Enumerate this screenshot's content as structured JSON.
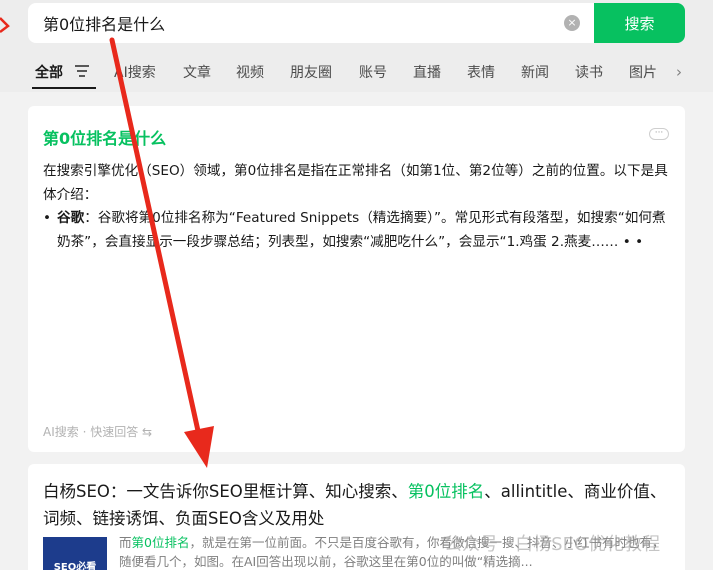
{
  "search": {
    "query": "第0位排名是什么",
    "clear_icon": "×",
    "button_label": "搜索"
  },
  "tabs": [
    {
      "label": "全部",
      "active": true
    },
    {
      "label": "AI搜索"
    },
    {
      "label": "文章"
    },
    {
      "label": "视频"
    },
    {
      "label": "朋友圈"
    },
    {
      "label": "账号"
    },
    {
      "label": "直播"
    },
    {
      "label": "表情"
    },
    {
      "label": "新闻"
    },
    {
      "label": "读书"
    },
    {
      "label": "图片"
    }
  ],
  "tabs_more_icon": "›",
  "ai_card": {
    "title": "第0位排名是什么",
    "more_icon": "···",
    "paragraph": "在搜索引擎优化（SEO）领域，第0位排名是指在正常排名（如第1位、第2位等）之前的位置。以下是具体介绍：",
    "bullet_label": "谷歌",
    "bullet_text": "：谷歌将第0位排名称为“Featured Snippets（精选摘要）”。常见形式有段落型，如搜索“如何煮奶茶”，会直接显示一段步骤总结；列表型，如搜索“减肥吃什么”，会显示“1.鸡蛋 2.燕麦……",
    "bullet_dots": "• •",
    "footer": "AI搜索 · 快速回答 ⇆"
  },
  "result": {
    "title_prefix": "白杨SEO：一文告诉你SEO里框计算、知心搜索、",
    "title_highlight": "第0位排名",
    "title_suffix": "、allintitle、商业价值、词频、链接诱饵、负面SEO含义及用处",
    "thumb_text": "SEO必看",
    "snippet_prefix": "而",
    "snippet_highlight": "第0位排名",
    "snippet_rest": "，就是在第一位前面。不只是百度谷歌有，你看微信搜一搜、抖音、小红书有时也有，随便看几个，如图。在AI回答出现以前，谷歌这里在第0位的叫做“精选摘..."
  },
  "watermark": "公众号 · 白杨SEO优化教程",
  "colors": {
    "accent": "#07c160",
    "arrow": "#e8291c"
  }
}
